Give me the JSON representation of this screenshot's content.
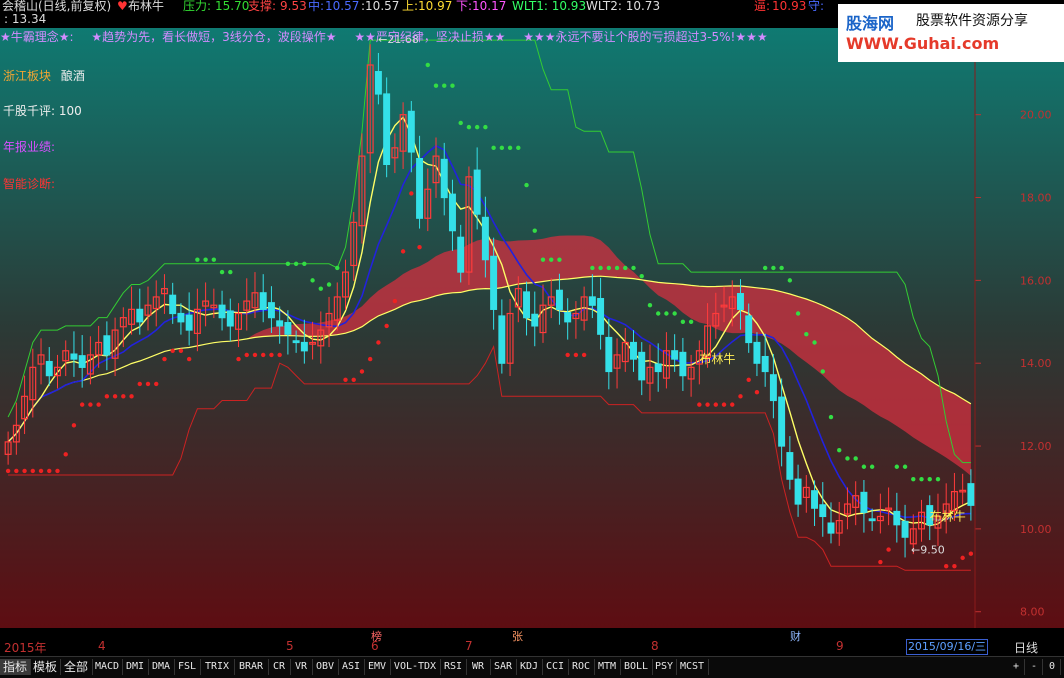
{
  "header": {
    "title": "会稽山(日线,前复权)",
    "indicator_name": "布林牛",
    "press_label": "压力:",
    "press_value": "15.70",
    "support_label": "支撑:",
    "support_value": "9.53",
    "mid_label": "中:",
    "mid_value": "10.57",
    "close_value": ":10.57",
    "upper_label": "上:",
    "upper_value": "10.97",
    "lower_label": "下:",
    "lower_value": "10.17",
    "wlt1": "WLT1: 10.93",
    "wlt2": "WLT2: 10.73",
    "line2": ": 13.34",
    "short_label": "逼:",
    "short_value": "10.93",
    "guard_label": "守:"
  },
  "slogans": [
    "★牛霸理念★:",
    "★趋势为先，看长做短，3线分仓，波段操作★",
    "★★严守纪律，坚决止损★★",
    "★★★永远不要让个股的亏损超过3-5%!★★★"
  ],
  "info": {
    "sector_label": "浙江板块",
    "sector_value": "酿酒",
    "rating_label": "千股千评:",
    "rating_value": "100",
    "report_label": "年报业绩:",
    "diag_label": "智能诊断:"
  },
  "logo": {
    "name": "股海网",
    "tagline": "股票软件资源分享",
    "url": "WWW.Guhai.com"
  },
  "annotations": {
    "high": "21.68",
    "low": "9.50",
    "signal1": "布林牛",
    "signal2": "布林牛"
  },
  "price_axis": [
    "20.00",
    "18.00",
    "16.00",
    "14.00",
    "12.00",
    "10.00",
    "8.00"
  ],
  "time_axis": [
    "2015年",
    "4",
    "5",
    "6",
    "7",
    "8",
    "9"
  ],
  "event_markers": [
    "榜",
    "张",
    "财"
  ],
  "current_date": "2015/09/16/三",
  "period": "日线",
  "tabs": [
    "指标",
    "模板",
    "全部",
    "MACD",
    "DMI",
    "DMA",
    "FSL",
    "TRIX",
    "BRAR",
    "CR",
    "VR",
    "OBV",
    "ASI",
    "EMV",
    "VOL-TDX",
    "RSI",
    "WR",
    "SAR",
    "KDJ",
    "CCI",
    "ROC",
    "MTM",
    "BOLL",
    "PSY",
    "MCST"
  ],
  "controls": [
    "+",
    "-",
    "0"
  ],
  "colors": {
    "up": "#ff3b3b",
    "down": "#34e0e8",
    "sar_up": "#33dd44",
    "sar_down": "#ee2222",
    "ma_yellow": "#ffff66",
    "ma_blue": "#2222dd",
    "resistance": "#33cc33"
  },
  "chart_data": {
    "type": "candlestick",
    "ylim": [
      7.8,
      21.9
    ],
    "closes": [
      12.1,
      12.5,
      13.2,
      13.9,
      14.2,
      13.7,
      13.9,
      14.3,
      14.1,
      13.9,
      14.2,
      14.5,
      14.2,
      14.8,
      15.1,
      15.3,
      15.0,
      15.4,
      15.6,
      15.8,
      15.2,
      15.0,
      14.8,
      15.3,
      15.5,
      15.4,
      15.1,
      14.9,
      15.2,
      15.5,
      15.7,
      15.3,
      15.1,
      14.9,
      14.7,
      14.5,
      14.3,
      14.5,
      14.8,
      15.2,
      15.6,
      16.2,
      17.4,
      19.0,
      21.2,
      20.5,
      18.8,
      19.2,
      20.0,
      19.1,
      17.5,
      18.2,
      19.0,
      18.0,
      17.2,
      16.2,
      18.5,
      17.6,
      16.5,
      15.3,
      14.0,
      15.2,
      15.8,
      15.1,
      14.9,
      15.4,
      15.6,
      15.3,
      15.0,
      15.2,
      15.6,
      15.4,
      14.7,
      13.8,
      14.2,
      14.5,
      14.1,
      13.6,
      13.9,
      13.8,
      14.3,
      14.1,
      13.7,
      13.9,
      14.3,
      14.9,
      15.2,
      15.4,
      15.6,
      15.3,
      14.5,
      14.0,
      13.8,
      13.1,
      12.0,
      11.2,
      10.6,
      11.0,
      10.5,
      10.3,
      9.9,
      10.2,
      10.6,
      10.8,
      10.4,
      10.2,
      10.3,
      10.5,
      10.1,
      9.8,
      10.0,
      10.4,
      10.1,
      10.3,
      10.6,
      10.9,
      10.93,
      10.57
    ],
    "highs_note": "approximate"
  }
}
